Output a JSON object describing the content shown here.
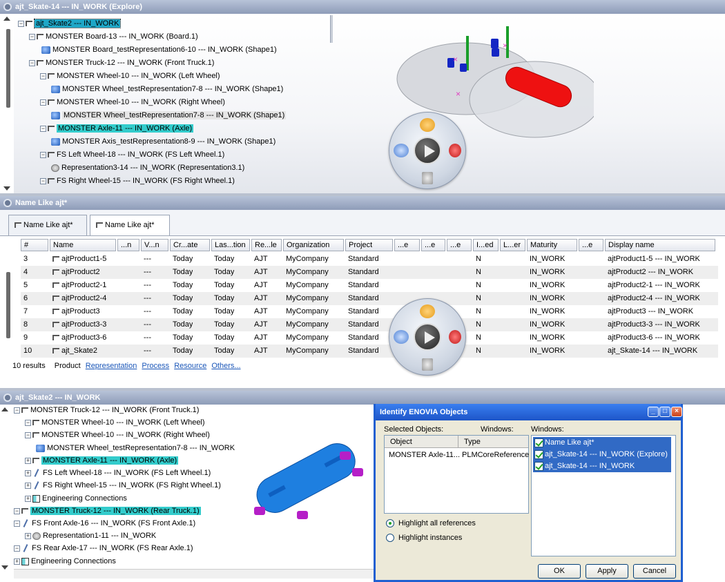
{
  "window1": {
    "title": "ajt_Skate-14 --- IN_WORK (Explore)",
    "tree": [
      {
        "label": "ajt_Skate2 --- IN_WORK",
        "style": "selected",
        "icon": "product"
      },
      {
        "label": "MONSTER Board-13 --- IN_WORK (Board.1)",
        "icon": "product"
      },
      {
        "label": "MONSTER Board_testRepresentation6-10 --- IN_WORK (Shape1)",
        "icon": "representation"
      },
      {
        "label": "MONSTER Truck-12 --- IN_WORK (Front Truck.1)",
        "icon": "product"
      },
      {
        "label": "MONSTER Wheel-10 --- IN_WORK (Left Wheel)",
        "icon": "product"
      },
      {
        "label": "MONSTER Wheel_testRepresentation7-8 --- IN_WORK (Shape1)",
        "icon": "representation"
      },
      {
        "label": "MONSTER Wheel-10 --- IN_WORK (Right Wheel)",
        "icon": "product"
      },
      {
        "label": "MONSTER Wheel_testRepresentation7-8 --- IN_WORK (Shape1)",
        "style": "gray",
        "icon": "representation"
      },
      {
        "label": "MONSTER Axle-11 --- IN_WORK (Axle)",
        "style": "highlight",
        "icon": "product"
      },
      {
        "label": "MONSTER Axis_testRepresentation8-9 --- IN_WORK (Shape1)",
        "icon": "representation"
      },
      {
        "label": "FS Left Wheel-18 --- IN_WORK (FS Left Wheel.1)",
        "icon": "product"
      },
      {
        "label": "Representation3-14 --- IN_WORK (Representation3.1)",
        "icon": "representation-3d"
      },
      {
        "label": "FS Right Wheel-15 --- IN_WORK (FS Right Wheel.1)",
        "icon": "product"
      }
    ]
  },
  "window2": {
    "title": "Name Like ajt*",
    "tabs": [
      "Name Like ajt*",
      "Name Like ajt*"
    ],
    "columns": [
      "#",
      "Name",
      "...n",
      "V...n",
      "Cr...ate",
      "Las...tion",
      "Re...le",
      "Organization",
      "Project",
      "...e",
      "...e",
      "...e",
      "I...ed",
      "L...er",
      "Maturity",
      "...e",
      "Display name"
    ],
    "rows": [
      {
        "num": "3",
        "name": "ajtProduct1-5",
        "v": "---",
        "cr": "Today",
        "las": "Today",
        "re": "AJT",
        "org": "MyCompany",
        "proj": "Standard",
        "i": "N",
        "mat": "IN_WORK",
        "disp": "ajtProduct1-5 --- IN_WORK"
      },
      {
        "num": "4",
        "name": "ajtProduct2",
        "v": "---",
        "cr": "Today",
        "las": "Today",
        "re": "AJT",
        "org": "MyCompany",
        "proj": "Standard",
        "i": "N",
        "mat": "IN_WORK",
        "disp": "ajtProduct2 --- IN_WORK"
      },
      {
        "num": "5",
        "name": "ajtProduct2-1",
        "v": "---",
        "cr": "Today",
        "las": "Today",
        "re": "AJT",
        "org": "MyCompany",
        "proj": "Standard",
        "i": "N",
        "mat": "IN_WORK",
        "disp": "ajtProduct2-1 --- IN_WORK"
      },
      {
        "num": "6",
        "name": "ajtProduct2-4",
        "v": "---",
        "cr": "Today",
        "las": "Today",
        "re": "AJT",
        "org": "MyCompany",
        "proj": "Standard",
        "i": "N",
        "mat": "IN_WORK",
        "disp": "ajtProduct2-4 --- IN_WORK"
      },
      {
        "num": "7",
        "name": "ajtProduct3",
        "v": "---",
        "cr": "Today",
        "las": "Today",
        "re": "AJT",
        "org": "MyCompany",
        "proj": "Standard",
        "i": "N",
        "mat": "IN_WORK",
        "disp": "ajtProduct3 --- IN_WORK"
      },
      {
        "num": "8",
        "name": "ajtProduct3-3",
        "v": "---",
        "cr": "Today",
        "las": "Today",
        "re": "AJT",
        "org": "MyCompany",
        "proj": "Standard",
        "i": "N",
        "mat": "IN_WORK",
        "disp": "ajtProduct3-3 --- IN_WORK"
      },
      {
        "num": "9",
        "name": "ajtProduct3-6",
        "v": "---",
        "cr": "Today",
        "las": "Today",
        "re": "AJT",
        "org": "MyCompany",
        "proj": "Standard",
        "i": "N",
        "mat": "IN_WORK",
        "disp": "ajtProduct3-6 --- IN_WORK"
      },
      {
        "num": "10",
        "name": "ajt_Skate2",
        "v": "---",
        "cr": "Today",
        "las": "Today",
        "re": "AJT",
        "org": "MyCompany",
        "proj": "Standard",
        "i": "N",
        "mat": "IN_WORK",
        "disp": "ajt_Skate-14 --- IN_WORK"
      }
    ],
    "results": "10 results",
    "filters": [
      "Product",
      "Representation",
      "Process",
      "Resource",
      "Others..."
    ]
  },
  "window3": {
    "title": "ajt_Skate2 --- IN_WORK",
    "tree": [
      {
        "label": "MONSTER Truck-12 --- IN_WORK (Front Truck.1)",
        "icon": "product"
      },
      {
        "label": "MONSTER Wheel-10 --- IN_WORK (Left Wheel)",
        "icon": "product"
      },
      {
        "label": "MONSTER Wheel-10 --- IN_WORK (Right Wheel)",
        "icon": "product"
      },
      {
        "label": "MONSTER Wheel_testRepresentation7-8 --- IN_WORK",
        "icon": "representation"
      },
      {
        "label": "MONSTER Axle-11 --- IN_WORK (Axle)",
        "style": "highlight",
        "icon": "product"
      },
      {
        "label": "FS Left Wheel-18 --- IN_WORK (FS Left Wheel.1)",
        "icon": "axle"
      },
      {
        "label": "FS Right Wheel-15 --- IN_WORK (FS Right Wheel.1)",
        "icon": "axle"
      },
      {
        "label": "Engineering Connections",
        "icon": "connections"
      },
      {
        "label": "MONSTER Truck-12 --- IN_WORK (Rear Truck.1)",
        "style": "highlight",
        "icon": "product"
      },
      {
        "label": "FS Front Axle-16 --- IN_WORK (FS Front Axle.1)",
        "icon": "axle"
      },
      {
        "label": "Representation1-11 --- IN_WORK",
        "icon": "representation-3d"
      },
      {
        "label": "FS Rear Axle-17 --- IN_WORK (FS Rear Axle.1)",
        "icon": "axle"
      },
      {
        "label": "Engineering Connections",
        "icon": "connections"
      }
    ]
  },
  "dialog": {
    "title": "Identify ENOVIA Objects",
    "selected_label": "Selected Objects:",
    "windows_label_1": "Windows:",
    "windows_label_2": "Windows:",
    "col_object": "Object",
    "col_type": "Type",
    "object_value": "MONSTER Axle-11...",
    "type_value": "PLMCoreReference",
    "windows": [
      "Name Like ajt*",
      "ajt_Skate-14 --- IN_WORK (Explore)",
      "ajt_Skate-14 --- IN_WORK"
    ],
    "radio_all": "Highlight all references",
    "radio_instances": "Highlight instances",
    "radio_selected": "all",
    "ok": "OK",
    "apply": "Apply",
    "cancel": "Cancel"
  },
  "colors": {
    "highlight": "#33cccc",
    "selection": "#1ea7c7",
    "dialog_title": "#1d55c8",
    "link": "#1a56b8"
  }
}
